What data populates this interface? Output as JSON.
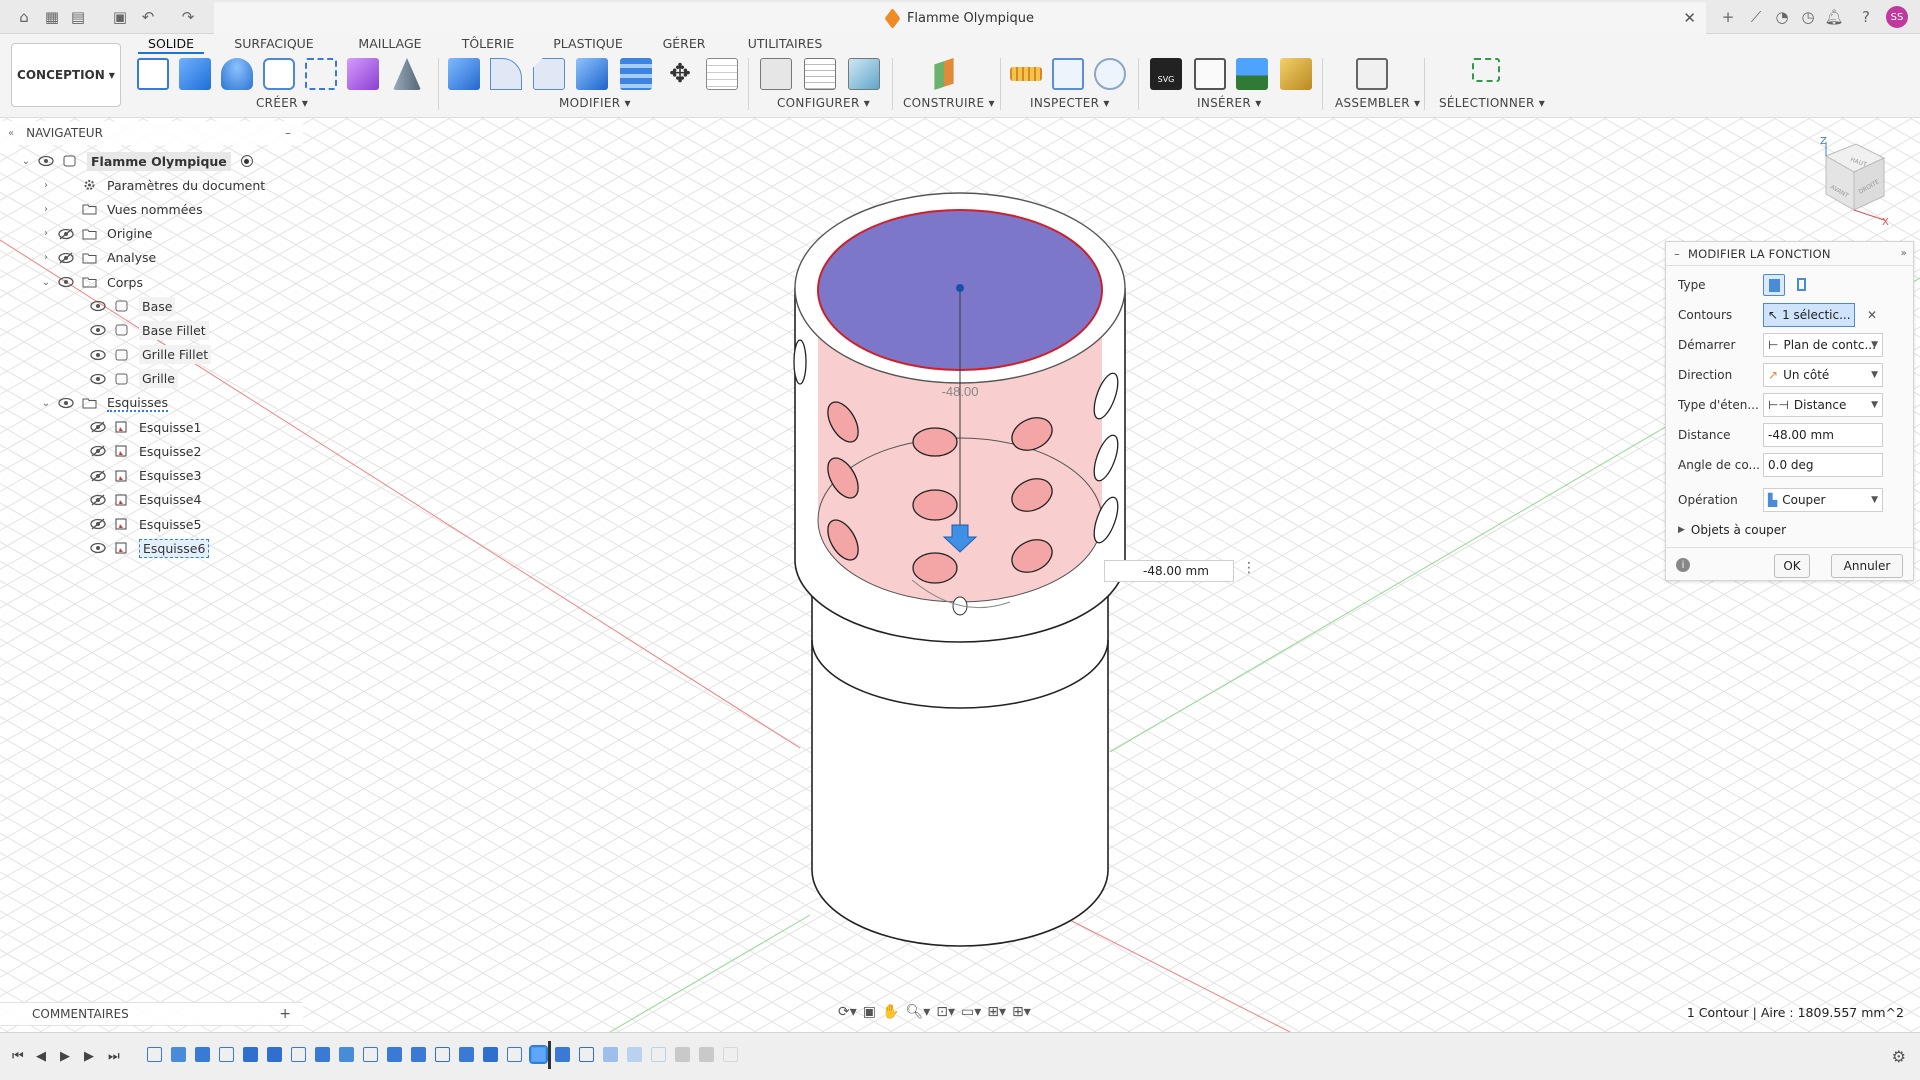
{
  "document": {
    "title": "Flamme Olympique",
    "user_initials": "SS"
  },
  "ribbon": {
    "workspace": "CONCEPTION",
    "tabs": [
      "SOLIDE",
      "SURFACIQUE",
      "MAILLAGE",
      "TÔLERIE",
      "PLASTIQUE",
      "GÉRER",
      "UTILITAIRES"
    ],
    "active_tab": "SOLIDE",
    "groups": [
      "CRÉER",
      "MODIFIER",
      "CONFIGURER",
      "CONSTRUIRE",
      "INSPECTER",
      "INSÉRER",
      "ASSEMBLER",
      "SÉLECTIONNER"
    ]
  },
  "navigator": {
    "title": "NAVIGATEUR",
    "items": [
      {
        "label": "Flamme Olympique",
        "level": 0
      },
      {
        "label": "Paramètres du document",
        "level": 1
      },
      {
        "label": "Vues nommées",
        "level": 1
      },
      {
        "label": "Origine",
        "level": 1
      },
      {
        "label": "Analyse",
        "level": 1
      },
      {
        "label": "Corps",
        "level": 1
      },
      {
        "label": "Base",
        "level": 2
      },
      {
        "label": "Base Fillet",
        "level": 2
      },
      {
        "label": "Grille Fillet",
        "level": 2
      },
      {
        "label": "Grille",
        "level": 2
      },
      {
        "label": "Esquisses",
        "level": 1
      },
      {
        "label": "Esquisse1",
        "level": 2
      },
      {
        "label": "Esquisse2",
        "level": 2
      },
      {
        "label": "Esquisse3",
        "level": 2
      },
      {
        "label": "Esquisse4",
        "level": 2
      },
      {
        "label": "Esquisse5",
        "level": 2
      },
      {
        "label": "Esquisse6",
        "level": 2
      }
    ]
  },
  "viewport": {
    "dimension_label": "-48.00",
    "distance_input": "-48.00 mm",
    "viewcube": {
      "top": "HAUT",
      "front": "AVANT",
      "right": "DROITE",
      "axis_z": "Z",
      "axis_x": "X"
    }
  },
  "dialog": {
    "title": "MODIFIER LA FONCTION",
    "type_label": "Type",
    "contours_label": "Contours",
    "contours_value": "1 sélectic...",
    "demarrer_label": "Démarrer",
    "demarrer_value": "Plan de contc...",
    "direction_label": "Direction",
    "direction_value": "Un côté",
    "extent_label": "Type d'éten...",
    "extent_value": "Distance",
    "distance_label": "Distance",
    "distance_value": "-48.00 mm",
    "angle_label": "Angle de co...",
    "angle_value": "0.0 deg",
    "operation_label": "Opération",
    "operation_value": "Couper",
    "objects_label": "Objets à couper",
    "ok": "OK",
    "cancel": "Annuler"
  },
  "comments": {
    "title": "COMMENTAIRES"
  },
  "status": "1 Contour | Aire : 1809.557 mm^2",
  "colors": {
    "accent": "#1a73d6",
    "profile_fill": "#7c77c9",
    "cut_fill": "#f6bdbd",
    "selection_edge": "#d11f2a"
  }
}
